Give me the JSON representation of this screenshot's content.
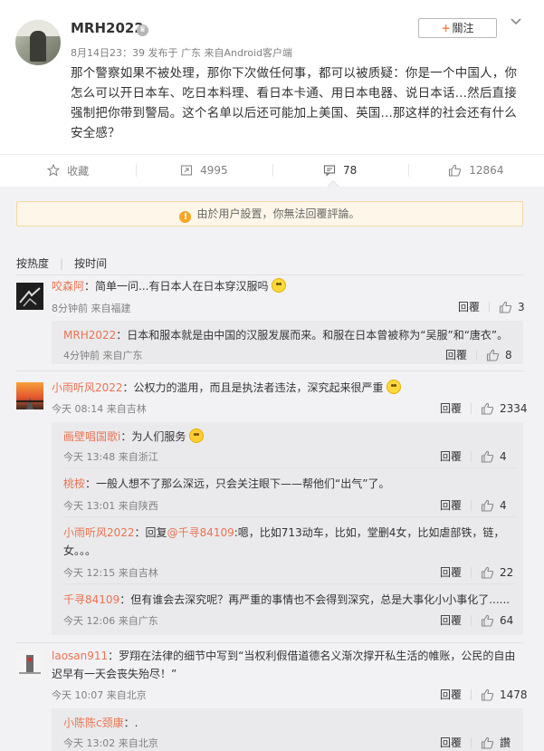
{
  "post": {
    "username": "MRH2022",
    "meta": "8月14日23：39 发布于 广东 来自Android客户端",
    "follow_label": "關注",
    "text": "那个警察如果不被处理，那你下次做任何事，都可以被质疑：你是一个中国人，你怎么可以开日本车、吃日本料理、看日本卡通、用日本电器、说日本话...然后直接强制把你带到警局。这个名单以后还可能加上美国、英国...那这样的社会还有什么安全感？"
  },
  "actions": {
    "favorite": "收藏",
    "repost": "4995",
    "comment": "78",
    "like": "12864"
  },
  "notice": "由於用户設置，你無法回覆評論。",
  "sort": {
    "hot": "按热度",
    "time": "按时间"
  },
  "comments": [
    {
      "name": "咬森阿",
      "text": "：简单一问...有日本人在日本穿汉服吗",
      "meta": "8分钟前 来自福建",
      "reply_label": "回覆",
      "likes": "3",
      "replies": [
        {
          "name": "MRH2022",
          "text": "：日本和服本就是由中国的汉服发展而来。和服在日本曾被称为“吴服”和“唐衣”。",
          "meta": "4分钟前 来自广东",
          "reply_label": "回覆",
          "likes": "8"
        }
      ]
    },
    {
      "name": "小雨听风2022",
      "text": "：公权力的滥用，而且是执法者违法，深究起来很严重",
      "meta": "今天 08:14 来自吉林",
      "reply_label": "回覆",
      "likes": "2334",
      "replies": [
        {
          "name": "画壁唱国歌i",
          "text": "：为人们服务",
          "meta": "今天 13:48 来自浙江",
          "reply_label": "回覆",
          "likes": "4"
        },
        {
          "name": "桃桉",
          "text": "：一般人想不了那么深远，只会关注眼下——帮他们“出气”了。",
          "meta": "今天 13:01 来自陕西",
          "reply_label": "回覆",
          "likes": "4"
        },
        {
          "name": "小雨听风2022",
          "mention": "@千寻84109",
          "text_pre": "：回复",
          "text": ":嗯，比如713动车，比如，堂删4女，比如虐部铁，链，女。。。",
          "meta": "今天 12:15 来自吉林",
          "reply_label": "回覆",
          "likes": "22"
        },
        {
          "name": "千寻84109",
          "text": "：但有谁会去深究呢？再严重的事情也不会得到深究，总是大事化小小事化了......",
          "meta": "今天 12:06 来自广东",
          "reply_label": "回覆",
          "likes": "64"
        }
      ]
    },
    {
      "name": "laosan911",
      "text": "：罗翔在法律的细节中写到“当权利假借道德名义渐次撑开私生活的帷账，公民的自由迟早有一天会丧失殆尽！”",
      "meta": "今天 10:07 来自北京",
      "reply_label": "回覆",
      "likes": "1478",
      "replies": [
        {
          "name": "小陈陈c颈康",
          "text": "：.",
          "meta": "今天 13:02 来自北京",
          "reply_label": "回覆",
          "likes": "讚"
        }
      ]
    }
  ],
  "colors": {
    "accent": "#eb7350",
    "link": "#eb7350",
    "follow_plus": "#ff8140",
    "notice_bg": "#fef6e8"
  }
}
